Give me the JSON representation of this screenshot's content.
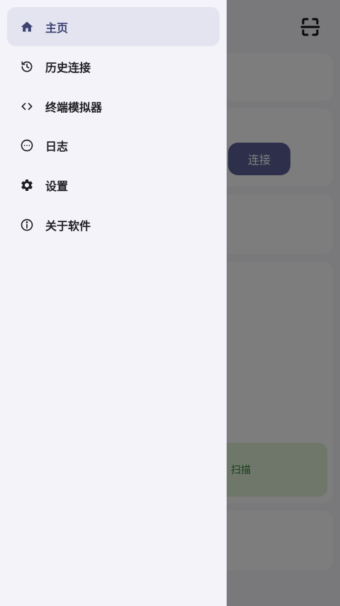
{
  "drawer": {
    "items": [
      {
        "label": "主页",
        "icon": "home-icon",
        "active": true
      },
      {
        "label": "历史连接",
        "icon": "history-icon",
        "active": false
      },
      {
        "label": "终端模拟器",
        "icon": "code-icon",
        "active": false
      },
      {
        "label": "日志",
        "icon": "more-circle-icon",
        "active": false
      },
      {
        "label": "设置",
        "icon": "gear-icon",
        "active": false
      },
      {
        "label": "关于软件",
        "icon": "info-icon",
        "active": false
      }
    ]
  },
  "background": {
    "connect_label": "连接",
    "scan_label": "扫描"
  },
  "colors": {
    "accent": "#3d4373",
    "active_bg": "#e3e4f0",
    "drawer_bg": "#f3f3f9"
  }
}
